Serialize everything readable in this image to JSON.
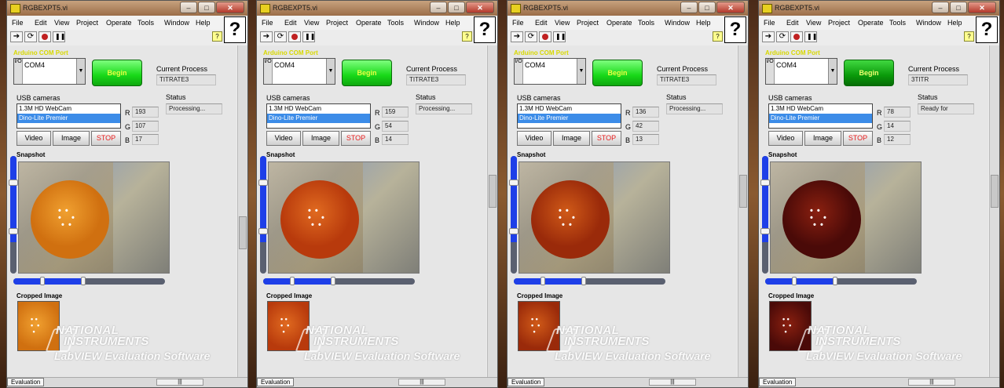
{
  "windows": [
    {
      "title": "RGBEXPT5.vi",
      "menu": [
        "File",
        "Edit",
        "View",
        "Project",
        "Operate",
        "Tools",
        "Window",
        "Help"
      ],
      "visa_label": "Arduino COM Port",
      "visa_value": "COM4",
      "begin_label": "Begin",
      "current_process_label": "Current Process",
      "current_process_value": "TITRATE3",
      "usb_cameras_label": "USB cameras",
      "cameras": [
        "1.3M HD WebCam",
        "Dino-Lite Premier"
      ],
      "selected_camera": "Dino-Lite Premier",
      "status_label": "Status",
      "status_value": "Processing...",
      "r_label": "R",
      "r_value": "193",
      "g_label": "G",
      "g_value": "107",
      "b_label": "B",
      "b_value": "17",
      "buttons": {
        "video": "Video",
        "image": "Image",
        "stop": "STOP"
      },
      "snapshot_label": "Snapshot",
      "cropped_label": "Cropped Image",
      "drop_color": "#d07010",
      "drop_rim_color": "#f0a030",
      "watermark": {
        "line1": "NATIONAL",
        "line2": "INSTRUMENTS",
        "line3": "LabVIEW Evaluation Software"
      },
      "eval_label": "Evaluation"
    },
    {
      "title": "RGBEXPT5.vi",
      "menu": [
        "File",
        "Edit",
        "View",
        "Project",
        "Operate",
        "Tools",
        "Window",
        "Help"
      ],
      "visa_label": "Arduino COM Port",
      "visa_value": "COM4",
      "begin_label": "Begin",
      "current_process_label": "Current Process",
      "current_process_value": "TITRATE3",
      "usb_cameras_label": "USB cameras",
      "cameras": [
        "1.3M HD WebCam",
        "Dino-Lite Premier"
      ],
      "selected_camera": "Dino-Lite Premier",
      "status_label": "Status",
      "status_value": "Processing...",
      "r_label": "R",
      "r_value": "159",
      "g_label": "G",
      "g_value": "54",
      "b_label": "B",
      "b_value": "14",
      "buttons": {
        "video": "Video",
        "image": "Image",
        "stop": "STOP"
      },
      "snapshot_label": "Snapshot",
      "cropped_label": "Cropped Image",
      "drop_color": "#b83a0c",
      "drop_rim_color": "#e06a20",
      "watermark": {
        "line1": "NATIONAL",
        "line2": "INSTRUMENTS",
        "line3": "LabVIEW Evaluation Software"
      },
      "eval_label": "Evaluation"
    },
    {
      "title": "RGBEXPT5.vi",
      "menu": [
        "File",
        "Edit",
        "View",
        "Project",
        "Operate",
        "Tools",
        "Window",
        "Help"
      ],
      "visa_label": "Arduino COM Port",
      "visa_value": "COM4",
      "begin_label": "Begin",
      "current_process_label": "Current Process",
      "current_process_value": "TITRATE3",
      "usb_cameras_label": "USB cameras",
      "cameras": [
        "1.3M HD WebCam",
        "Dino-Lite Premier"
      ],
      "selected_camera": "Dino-Lite Premier",
      "status_label": "Status",
      "status_value": "Processing...",
      "r_label": "R",
      "r_value": "136",
      "g_label": "G",
      "g_value": "42",
      "b_label": "B",
      "b_value": "13",
      "buttons": {
        "video": "Video",
        "image": "Image",
        "stop": "STOP"
      },
      "snapshot_label": "Snapshot",
      "cropped_label": "Cropped Image",
      "drop_color": "#9a2a0a",
      "drop_rim_color": "#d05a18",
      "watermark": {
        "line1": "NATIONAL",
        "line2": "INSTRUMENTS",
        "line3": "LabVIEW Evaluation Software"
      },
      "eval_label": "Evaluation"
    },
    {
      "title": "RGBEXPT5.vi",
      "menu": [
        "File",
        "Edit",
        "View",
        "Project",
        "Operate",
        "Tools",
        "Window",
        "Help"
      ],
      "visa_label": "Arduino COM Port",
      "visa_value": "COM4",
      "begin_label": "Begin",
      "current_process_label": "Current Process",
      "current_process_value": "3TITR",
      "usb_cameras_label": "USB cameras",
      "cameras": [
        "1.3M HD WebCam",
        "Dino-Lite Premier"
      ],
      "selected_camera": "Dino-Lite Premier",
      "status_label": "Status",
      "status_value": "Ready for",
      "r_label": "R",
      "r_value": "78",
      "g_label": "G",
      "g_value": "14",
      "b_label": "B",
      "b_value": "12",
      "buttons": {
        "video": "Video",
        "image": "Image",
        "stop": "STOP"
      },
      "snapshot_label": "Snapshot",
      "cropped_label": "Cropped Image",
      "drop_color": "#4a0a08",
      "drop_rim_color": "#8a2010",
      "watermark": {
        "line1": "NATIONAL",
        "line2": "INSTRUMENTS",
        "line3": "LabVIEW Evaluation Software"
      },
      "eval_label": "Evaluation"
    }
  ],
  "window_controls": {
    "minimize": "–",
    "maximize": "□",
    "close": "✕"
  },
  "colors": {
    "begin_green": "#18d818",
    "slider_blue": "#1e3fe8",
    "visa_label_yellow": "#d8d800",
    "stop_red": "#e81c1c"
  }
}
